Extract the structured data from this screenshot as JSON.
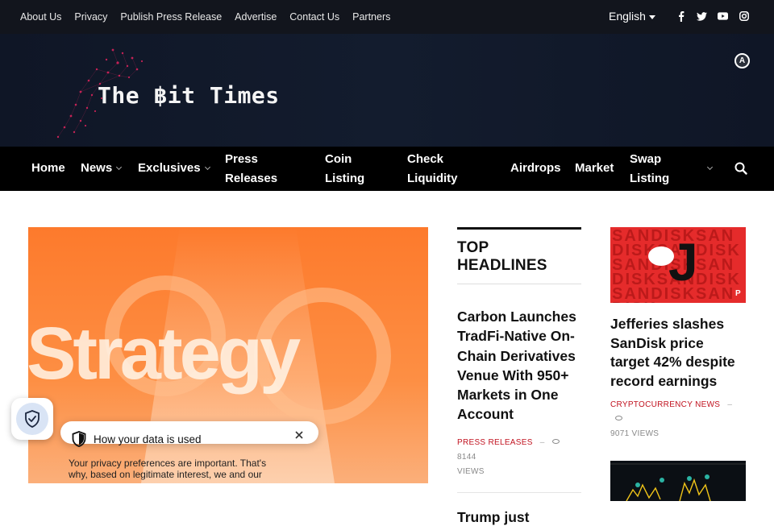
{
  "topbar": {
    "links": [
      "About Us",
      "Privacy",
      "Publish Press Release",
      "Advertise",
      "Contact Us",
      "Partners"
    ],
    "language": "English",
    "social_icons": [
      "facebook-icon",
      "twitter-icon",
      "youtube-icon",
      "instagram-icon"
    ]
  },
  "header": {
    "logo_text": "The ฿it Times",
    "badge_icon": "a-badge-icon"
  },
  "nav": {
    "items": [
      {
        "label": "Home"
      },
      {
        "label": "News"
      },
      {
        "label": "Exclusives"
      },
      {
        "label": "Press Releases"
      },
      {
        "label": "Coin Listing"
      },
      {
        "label": "Check Liquidity"
      },
      {
        "label": "Airdrops"
      },
      {
        "label": "Market"
      },
      {
        "label": "Swap Listing"
      }
    ],
    "search_icon": "search-icon"
  },
  "hero": {
    "image_word": "Strategy"
  },
  "top_headlines": {
    "title": "TOP HEADLINES",
    "articles": [
      {
        "headline": "Carbon Launches TradFi-Native On-Chain Derivatives Venue With 950+ Markets in One Account",
        "category": "PRESS RELEASES",
        "views": "8144",
        "views_label": "VIEWS"
      },
      {
        "headline": "Trump just"
      }
    ]
  },
  "side": {
    "articles": [
      {
        "headline": "Jefferies slashes SanDisk price target 42% despite record earnings",
        "category": "CRYPTOCURRENCY NEWS",
        "views": "9071",
        "views_label": "VIEWS"
      }
    ]
  },
  "privacy": {
    "title": "How your data is used",
    "body": "Your privacy preferences are important. That's why, based on legitimate interest, we and our"
  },
  "colors": {
    "topbar_bg": "#12151d",
    "nav_bg": "#000000",
    "accent_red": "#c1121f",
    "hero_orange": "#fd7a2c"
  }
}
